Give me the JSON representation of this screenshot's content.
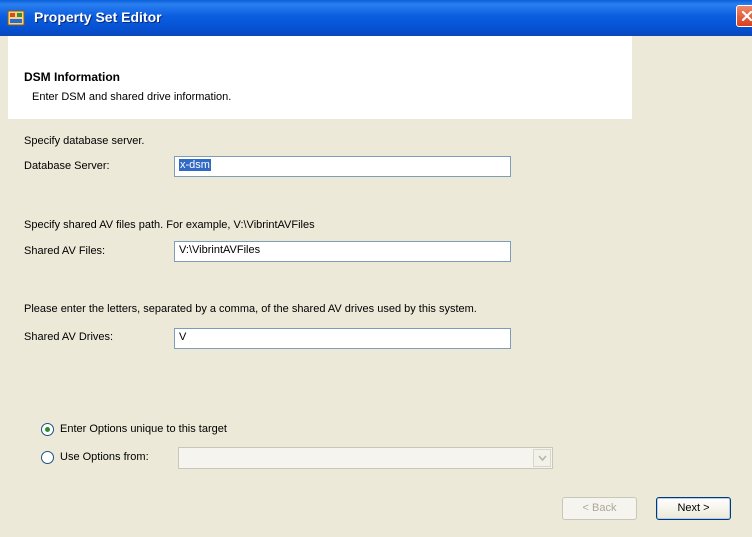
{
  "window": {
    "title": "Property Set Editor"
  },
  "header": {
    "title": "DSM Information",
    "subtitle": "Enter DSM and shared drive information."
  },
  "database": {
    "instruction": "Specify database server.",
    "label": "Database Server:",
    "value": "x-dsm"
  },
  "shared_files": {
    "instruction": "Specify shared AV files path.  For example, V:\\VibrintAVFiles",
    "label": "Shared AV Files:",
    "value": "V:\\VibrintAVFiles"
  },
  "shared_drives": {
    "instruction": "Please enter the letters, separated by a comma, of the shared AV drives used by this system.",
    "label": "Shared AV Drives:",
    "value": "V"
  },
  "options": {
    "unique_label": "Enter Options unique to this target",
    "unique_selected": true,
    "from_label": "Use Options from:",
    "from_selected": false,
    "from_value": ""
  },
  "buttons": {
    "back": "< Back",
    "next": "Next >"
  },
  "colors": {
    "titlebar": "#0b5de0",
    "dialog_bg": "#ece9d8",
    "selection": "#316ac5"
  }
}
